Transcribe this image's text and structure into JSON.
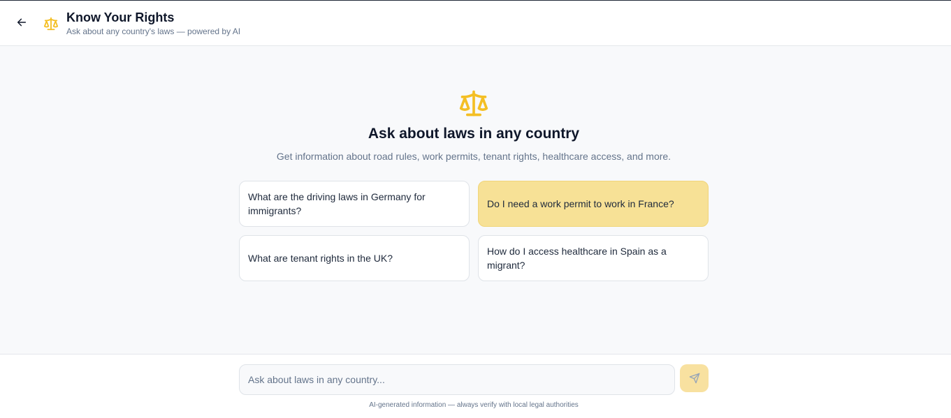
{
  "colors": {
    "accent": "#f4bf24",
    "accent_soft": "#f7e196",
    "send_button_bg": "#f8e1a0",
    "background_main": "#f8f9fb",
    "text_primary": "#0f172a",
    "text_muted": "#64748b"
  },
  "header": {
    "back_icon": "arrow-left-icon",
    "logo_icon": "scales-icon",
    "title": "Know Your Rights",
    "subtitle": "Ask about any country's laws — powered by AI"
  },
  "hero": {
    "icon": "scales-icon",
    "title": "Ask about laws in any country",
    "description": "Get information about road rules, work permits, tenant rights, healthcare access, and more."
  },
  "suggestions": [
    {
      "label": "What are the driving laws in Germany for immigrants?"
    },
    {
      "label": "Do I need a work permit to work in France?"
    },
    {
      "label": "What are tenant rights in the UK?"
    },
    {
      "label": "How do I access healthcare in Spain as a migrant?"
    }
  ],
  "composer": {
    "placeholder": "Ask about laws in any country...",
    "value": "",
    "send_icon": "send-icon",
    "disclaimer": "AI-generated information — always verify with local legal authorities"
  }
}
